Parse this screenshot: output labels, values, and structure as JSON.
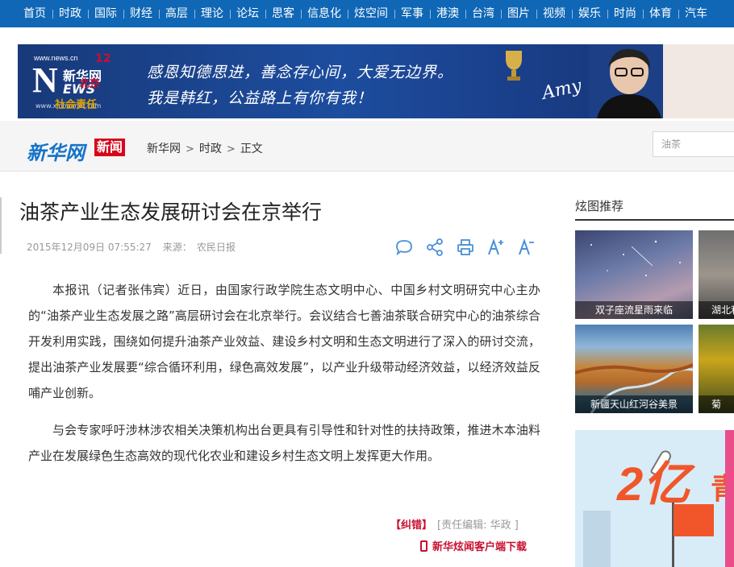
{
  "nav": {
    "items": [
      "首页",
      "时政",
      "国际",
      "财经",
      "高层",
      "理论",
      "论坛",
      "思客",
      "信息化",
      "炫空间",
      "军事",
      "港澳",
      "台湾",
      "图片",
      "视频",
      "娱乐",
      "时尚",
      "体育",
      "汽车"
    ]
  },
  "banner": {
    "logo_url": "www.news.cn",
    "logo_n": "N",
    "logo_cn": "新华网",
    "logo_ews": "EWS",
    "logo_url2": "www.xinhuanet.com",
    "slogan_line1": "感恩知德思进，善念存心间，大爱无边界。",
    "slogan_line2": "我是韩红，公益路上有你有我！",
    "signature": "Amy",
    "right_num": "12",
    "right_city": "北京",
    "right_sub": "社会责任"
  },
  "header": {
    "logo": "新华网",
    "news_tag": "新闻",
    "breadcrumb": [
      "新华网",
      "时政",
      "正文"
    ],
    "search_value": "油茶"
  },
  "article": {
    "title": "油茶产业生态发展研讨会在京举行",
    "datetime": "2015年12月09日 07:55:27",
    "source_label": "来源：",
    "source": "农民日报",
    "paragraphs": [
      "本报讯（记者张伟宾）近日，由国家行政学院生态文明中心、中国乡村文明研究中心主办的“油茶产业生态发展之路”高层研讨会在北京举行。会议结合七善油茶联合研究中心的油茶综合开发利用实践，围绕如何提升油茶产业效益、建设乡村文明和生态文明进行了深入的研讨交流，提出油茶产业发展要“综合循环利用，绿色高效发展”，以产业升级带动经济效益，以经济效益反哺产业创新。",
      "与会专家呼吁涉林涉农相关决策机构出台更具有引导性和针对性的扶持政策，推进木本油料产业在发展绿色生态高效的现代化农业和建设乡村生态文明上发挥更大作用。"
    ],
    "correction_label": "【纠错】",
    "editor": "[责任编辑: 华政 ]",
    "app_download": "新华炫闻客户端下载"
  },
  "sidebar": {
    "title": "炫图推荐",
    "thumbs": [
      {
        "caption": "双子座流星雨来临"
      },
      {
        "caption": "湖北利"
      },
      {
        "caption": "新疆天山红河谷美景"
      },
      {
        "caption": "菊"
      }
    ],
    "ad": {
      "big_text": "2亿",
      "right_char": "青"
    }
  },
  "colors": {
    "nav_bg": "#0f67b6",
    "brand_red": "#c8102e",
    "brand_blue": "#1473c8",
    "icon_blue": "#4a90d9"
  }
}
